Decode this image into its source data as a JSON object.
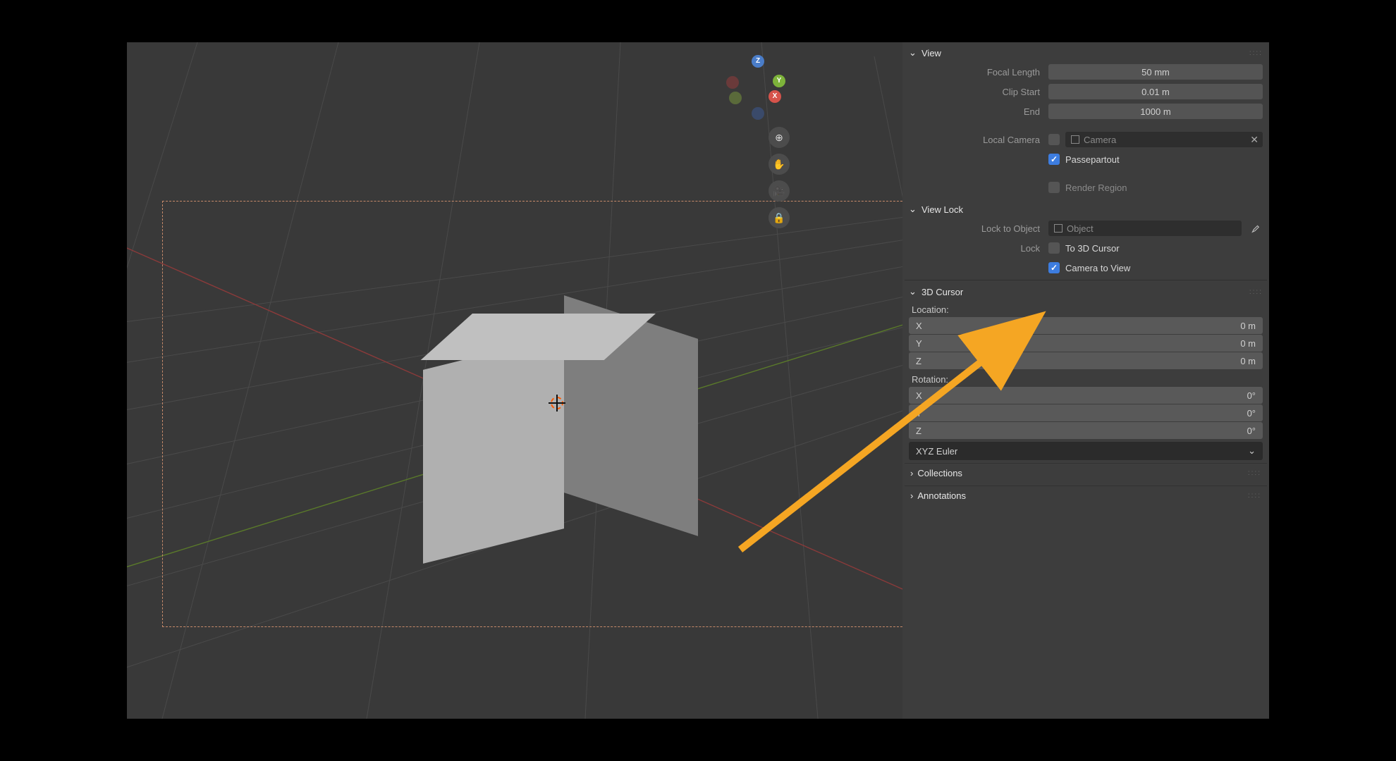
{
  "panel": {
    "view": {
      "title": "View",
      "focal_length_label": "Focal Length",
      "focal_length_value": "50 mm",
      "clip_start_label": "Clip Start",
      "clip_start_value": "0.01 m",
      "clip_end_label": "End",
      "clip_end_value": "1000 m",
      "local_camera_label": "Local Camera",
      "local_camera_value": "Camera",
      "passepartout_label": "Passepartout",
      "render_region_label": "Render Region"
    },
    "view_lock": {
      "title": "View Lock",
      "lock_to_object_label": "Lock to Object",
      "lock_to_object_placeholder": "Object",
      "lock_label": "Lock",
      "to_3d_cursor_label": "To 3D Cursor",
      "camera_to_view_label": "Camera to View"
    },
    "cursor3d": {
      "title": "3D Cursor",
      "location_label": "Location:",
      "rotation_label": "Rotation:",
      "loc_x_label": "X",
      "loc_x_value": "0 m",
      "loc_y_label": "Y",
      "loc_y_value": "0 m",
      "loc_z_label": "Z",
      "loc_z_value": "0 m",
      "rot_x_label": "X",
      "rot_x_value": "0°",
      "rot_y_label": "Y",
      "rot_y_value": "0°",
      "rot_z_label": "Z",
      "rot_z_value": "0°",
      "rotation_mode": "XYZ Euler"
    },
    "collections_title": "Collections",
    "annotations_title": "Annotations"
  },
  "gizmo": {
    "x": "X",
    "y": "Y",
    "z": "Z"
  },
  "tool_icons": {
    "zoom": "⊕",
    "pan": "✋",
    "camera": "🎥",
    "lock": "🔒"
  }
}
